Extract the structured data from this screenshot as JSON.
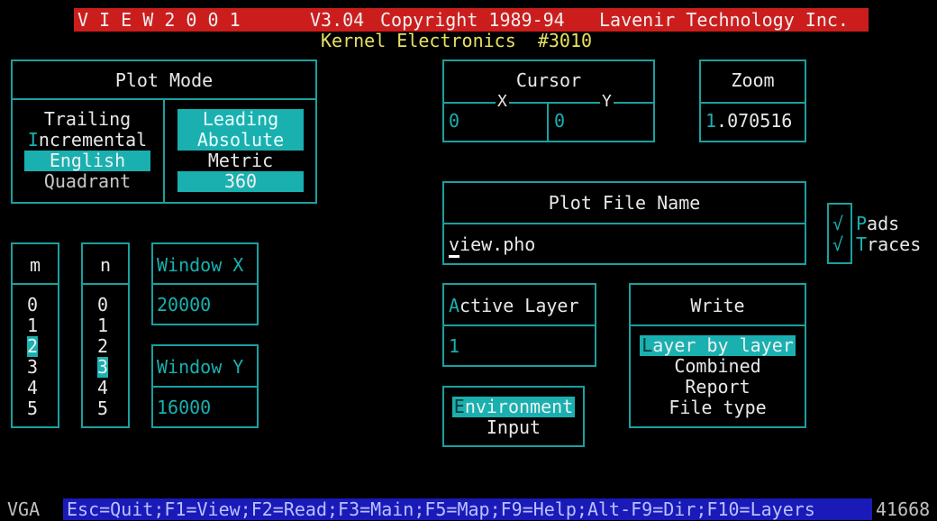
{
  "title_bar": {
    "name": "V I E W 2 0 0 1",
    "version": "V3.04",
    "copyright": "Copyright 1989-94",
    "company": "Lavenir Technology Inc."
  },
  "subtitle": "Kernel Electronics  #3010",
  "plot_mode": {
    "title": "Plot Mode",
    "left_options": [
      "Trailing",
      "Incremental",
      "English",
      "Quadrant"
    ],
    "right_options": [
      "Leading",
      "Absolute",
      "Metric",
      "360"
    ]
  },
  "cursor": {
    "title": "Cursor",
    "x_label": "X",
    "y_label": "Y",
    "x_value": "0",
    "y_value": "0"
  },
  "zoom": {
    "title": "Zoom",
    "value": "1.070516"
  },
  "plot_file": {
    "title": "Plot File Name",
    "value": "view.pho"
  },
  "checkboxes": [
    {
      "mark": "√",
      "label": "Pads"
    },
    {
      "mark": "√",
      "label": "Traces"
    }
  ],
  "m_list": {
    "title": "m",
    "items": [
      "0",
      "1",
      "2",
      "3",
      "4",
      "5"
    ],
    "selected": "2"
  },
  "n_list": {
    "title": "n",
    "items": [
      "0",
      "1",
      "2",
      "3",
      "4",
      "5"
    ],
    "selected": "3"
  },
  "window_x": {
    "title": "Window X",
    "value": "20000"
  },
  "window_y": {
    "title": "Window Y",
    "value": "16000"
  },
  "active_layer": {
    "title": "Active Layer",
    "value": "1"
  },
  "write": {
    "title": "Write",
    "options": [
      "Layer by layer",
      "Combined",
      "Report",
      "File type"
    ]
  },
  "env": {
    "options": [
      "Environment",
      "Input"
    ]
  },
  "status_bar": {
    "mode": "VGA",
    "keys": "Esc=Quit;F1=View;F2=Read;F3=Main;F5=Map;F9=Help;Alt-F9=Dir;F10=Layers",
    "memory": "41668"
  },
  "colors": {
    "title_bg": "#cc1d1d",
    "border": "#1aa0a0",
    "highlight": "#1ab0b0",
    "subtitle": "#e8e060",
    "status_bg": "#1a1ab8"
  }
}
